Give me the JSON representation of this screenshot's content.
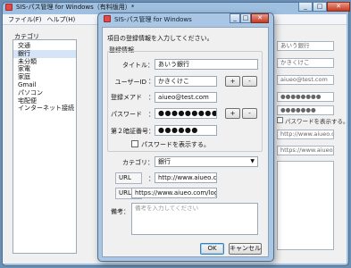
{
  "main_window": {
    "title": "SIS-パス管理 for Windows（有料版用）",
    "title_suffix": "*",
    "menu": [
      "ファイル(F)",
      "ヘルプ(H)"
    ],
    "category_label": "カテゴリ",
    "categories": [
      "交通",
      "銀行",
      "未分類",
      "家電",
      "家庭",
      "Gmail",
      "パソコン",
      "宅配便",
      "インターネット接続"
    ],
    "selected_category_index": 1,
    "right_fields": {
      "f1": "あいう銀行",
      "f2": "かきくけこ",
      "f3": "aiueo@test.com",
      "f4": "●●●●●●●●",
      "f5": "●●●●●●●",
      "show_pw": "パスワードを表示する。",
      "f6": "http://www.aiueo.com",
      "f7": "https://www.aiueo.com"
    }
  },
  "dialog": {
    "title": "SIS-パス管理 for Windows",
    "instruction": "項目の登録情報を入力してください。",
    "group_label": "登録情報",
    "fields": {
      "title_label": "タイトル：",
      "title_value": "あいう銀行",
      "userid_label": "ユーザーID",
      "userid_value": "かきくけこ",
      "email_label": "登録メアド",
      "email_value": "aiueo@test.com",
      "password_label": "パスワード",
      "password_value": "●●●●●●●●●●",
      "pin_label": "第２暗証番号",
      "pin_value": "●●●●●●",
      "show_password_label": "パスワードを表示する。",
      "category_label": "カテゴリ：",
      "category_value": "銀行",
      "url_label": "URL",
      "url_value": "http://www.aiueo.com",
      "url2_label": "URL2",
      "url2_value": "https://www.aiueo.com/login",
      "note_label": "備考：",
      "note_placeholder": "備考を入力してください"
    },
    "plus_label": "+",
    "minus_label": "-",
    "ok_label": "OK",
    "cancel_label": "キャンセル",
    "colon": "："
  }
}
